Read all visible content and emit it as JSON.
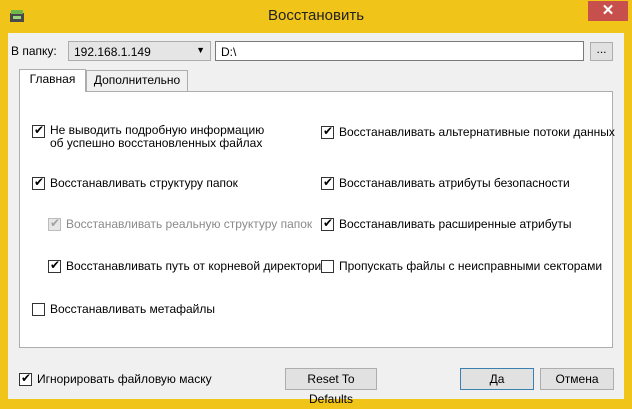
{
  "window": {
    "title": "Восстановить",
    "close_glyph": "✕"
  },
  "folder": {
    "label": "В папку:",
    "host": "192.168.1.149",
    "path": "D:\\",
    "browse": "..."
  },
  "tabs": [
    {
      "label": "Главная"
    },
    {
      "label": "Дополнительно"
    }
  ],
  "options": {
    "no_verbose_1": "Не выводить подробную информацию",
    "no_verbose_2": "об успешно восстановленных файлах",
    "restore_structure": "Восстанавливать структуру папок",
    "restore_real_structure": "Восстанавливать реальную структуру папок",
    "restore_root_path": "Восстанавливать путь от корневой директории",
    "restore_metafiles": "Восстанавливать метафайлы",
    "restore_alt_streams": "Восстанавливать альтернативные потоки данных",
    "restore_security": "Восстанавливать атрибуты безопасности",
    "restore_ext_attrs": "Восстанавливать расширенные атрибуты",
    "skip_bad_sectors": "Пропускать файлы с неисправными секторами"
  },
  "footer": {
    "ignore_mask": "Игнорировать файловую маску",
    "reset": "Reset To Defaults",
    "ok": "Да",
    "cancel": "Отмена"
  },
  "colors": {
    "titlebar": "#f0c419",
    "close": "#c7504d"
  }
}
